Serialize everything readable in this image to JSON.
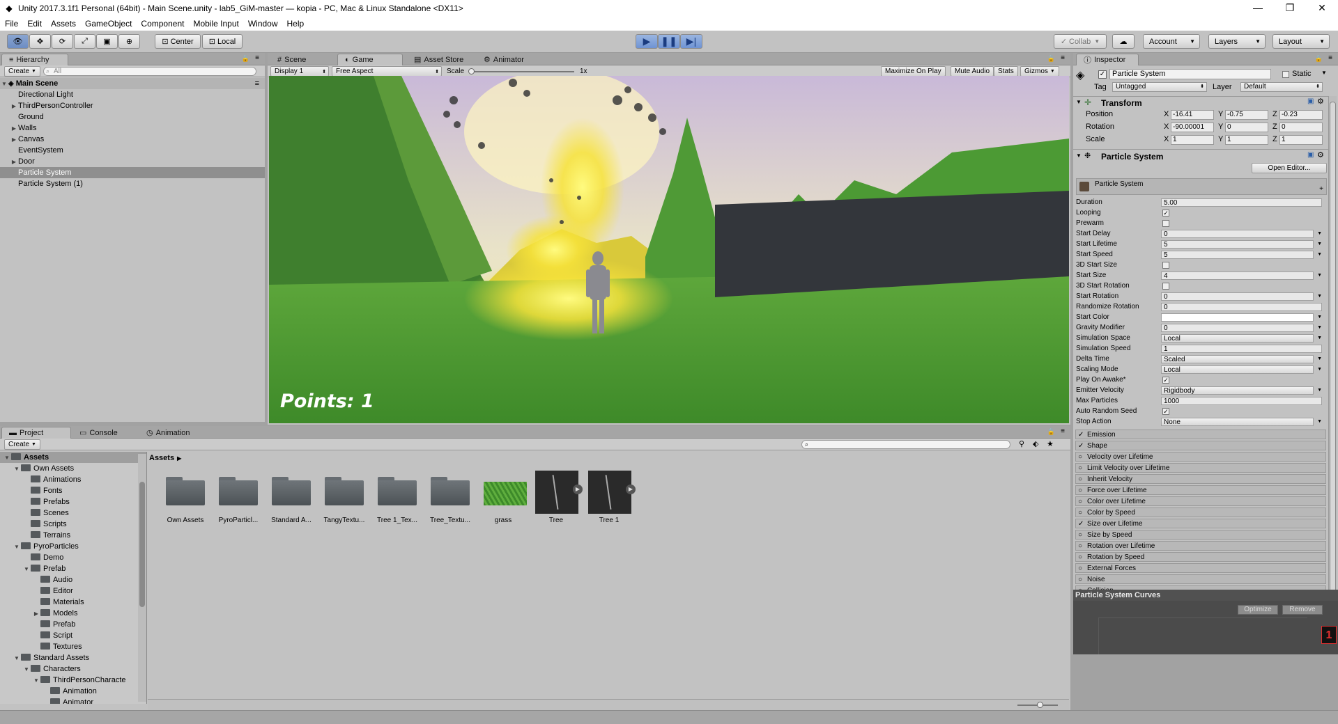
{
  "window": {
    "title": "Unity 2017.3.1f1 Personal (64bit) - Main Scene.unity - lab5_GiM-master — kopia - PC, Mac & Linux Standalone <DX11>",
    "minimize": "—",
    "maximize": "❐",
    "close": "✕"
  },
  "menu": [
    "File",
    "Edit",
    "Assets",
    "GameObject",
    "Component",
    "Mobile Input",
    "Window",
    "Help"
  ],
  "toolbar": {
    "center_label": "Center",
    "local_label": "Local",
    "collab_label": "Collab",
    "account_label": "Account",
    "layers_label": "Layers",
    "layout_label": "Layout"
  },
  "hierarchy": {
    "tab_label": "Hierarchy",
    "create_label": "Create",
    "search_placeholder": "All",
    "scene_name": "Main Scene",
    "items": [
      {
        "label": "Directional Light",
        "expandable": false
      },
      {
        "label": "ThirdPersonController",
        "expandable": true
      },
      {
        "label": "Ground",
        "expandable": false
      },
      {
        "label": "Walls",
        "expandable": true
      },
      {
        "label": "Canvas",
        "expandable": true
      },
      {
        "label": "EventSystem",
        "expandable": false
      },
      {
        "label": "Door",
        "expandable": true
      },
      {
        "label": "Particle System",
        "expandable": false,
        "selected": true
      },
      {
        "label": "Particle System (1)",
        "expandable": false
      }
    ]
  },
  "center_tabs": {
    "scene": "Scene",
    "game": "Game",
    "asset_store": "Asset Store",
    "animator": "Animator"
  },
  "game_bar": {
    "display": "Display 1",
    "aspect": "Free Aspect",
    "scale_label": "Scale",
    "scale_value": "1x",
    "maximize": "Maximize On Play",
    "mute": "Mute Audio",
    "stats": "Stats",
    "gizmos": "Gizmos"
  },
  "game_view": {
    "points_text": "Points: 1"
  },
  "inspector": {
    "tab_label": "Inspector",
    "object_name": "Particle System",
    "static_label": "Static",
    "tag_label": "Tag",
    "tag_value": "Untagged",
    "layer_label": "Layer",
    "layer_value": "Default",
    "transform": {
      "title": "Transform",
      "rows": [
        {
          "label": "Position",
          "x": "-16.41",
          "y": "-0.75",
          "z": "-0.23"
        },
        {
          "label": "Rotation",
          "x": "-90.00001",
          "y": "0",
          "z": "0"
        },
        {
          "label": "Scale",
          "x": "1",
          "y": "1",
          "z": "1"
        }
      ]
    },
    "particle": {
      "title": "Particle System",
      "open_editor": "Open Editor...",
      "sub_header": "Particle System",
      "props": [
        {
          "label": "Duration",
          "value": "5.00"
        },
        {
          "label": "Looping",
          "check": true
        },
        {
          "label": "Prewarm",
          "check": false
        },
        {
          "label": "Start Delay",
          "value": "0",
          "dd": true
        },
        {
          "label": "Start Lifetime",
          "value": "5",
          "dd": true
        },
        {
          "label": "Start Speed",
          "value": "5",
          "dd": true
        },
        {
          "label": "3D Start Size",
          "check": false
        },
        {
          "label": "Start Size",
          "value": "4",
          "dd": true
        },
        {
          "label": "3D Start Rotation",
          "check": false
        },
        {
          "label": "Start Rotation",
          "value": "0",
          "dd": true
        },
        {
          "label": "Randomize Rotation",
          "value": "0"
        },
        {
          "label": "Start Color",
          "color": "#ffffff"
        },
        {
          "label": "Gravity Modifier",
          "value": "0",
          "dd": true
        },
        {
          "label": "Simulation Space",
          "value": "Local",
          "dd": true
        },
        {
          "label": "Simulation Speed",
          "value": "1"
        },
        {
          "label": "Delta Time",
          "value": "Scaled",
          "dd": true
        },
        {
          "label": "Scaling Mode",
          "value": "Local",
          "dd": true
        },
        {
          "label": "Play On Awake*",
          "check": true
        },
        {
          "label": "Emitter Velocity",
          "value": "Rigidbody",
          "dd": true
        },
        {
          "label": "Max Particles",
          "value": "1000"
        },
        {
          "label": "Auto Random Seed",
          "check": true
        },
        {
          "label": "Stop Action",
          "value": "None",
          "dd": true
        }
      ],
      "modules": [
        {
          "label": "Emission",
          "on": true
        },
        {
          "label": "Shape",
          "on": true
        },
        {
          "label": "Velocity over Lifetime",
          "on": false
        },
        {
          "label": "Limit Velocity over Lifetime",
          "on": false
        },
        {
          "label": "Inherit Velocity",
          "on": false
        },
        {
          "label": "Force over Lifetime",
          "on": false
        },
        {
          "label": "Color over Lifetime",
          "on": false
        },
        {
          "label": "Color by Speed",
          "on": false
        },
        {
          "label": "Size over Lifetime",
          "on": true
        },
        {
          "label": "Size by Speed",
          "on": false
        },
        {
          "label": "Rotation over Lifetime",
          "on": false
        },
        {
          "label": "Rotation by Speed",
          "on": false
        },
        {
          "label": "External Forces",
          "on": false
        },
        {
          "label": "Noise",
          "on": false
        },
        {
          "label": "Collision",
          "on": false
        }
      ]
    },
    "curves": {
      "title": "Particle System Curves",
      "optimize": "Optimize",
      "remove": "Remove",
      "value_marker": "1"
    }
  },
  "bottom_tabs": {
    "project": "Project",
    "console": "Console",
    "animation": "Animation"
  },
  "project": {
    "create_label": "Create",
    "breadcrumb": "Assets",
    "tree": [
      {
        "label": "Assets",
        "depth": 0,
        "arrow": "▼",
        "bold": true
      },
      {
        "label": "Own Assets",
        "depth": 1,
        "arrow": "▼"
      },
      {
        "label": "Animations",
        "depth": 2,
        "arrow": ""
      },
      {
        "label": "Fonts",
        "depth": 2,
        "arrow": ""
      },
      {
        "label": "Prefabs",
        "depth": 2,
        "arrow": ""
      },
      {
        "label": "Scenes",
        "depth": 2,
        "arrow": ""
      },
      {
        "label": "Scripts",
        "depth": 2,
        "arrow": ""
      },
      {
        "label": "Terrains",
        "depth": 2,
        "arrow": ""
      },
      {
        "label": "PyroParticles",
        "depth": 1,
        "arrow": "▼"
      },
      {
        "label": "Demo",
        "depth": 2,
        "arrow": ""
      },
      {
        "label": "Prefab",
        "depth": 2,
        "arrow": "▼"
      },
      {
        "label": "Audio",
        "depth": 3,
        "arrow": ""
      },
      {
        "label": "Editor",
        "depth": 3,
        "arrow": ""
      },
      {
        "label": "Materials",
        "depth": 3,
        "arrow": ""
      },
      {
        "label": "Models",
        "depth": 3,
        "arrow": "▶"
      },
      {
        "label": "Prefab",
        "depth": 3,
        "arrow": ""
      },
      {
        "label": "Script",
        "depth": 3,
        "arrow": ""
      },
      {
        "label": "Textures",
        "depth": 3,
        "arrow": ""
      },
      {
        "label": "Standard Assets",
        "depth": 1,
        "arrow": "▼"
      },
      {
        "label": "Characters",
        "depth": 2,
        "arrow": "▼"
      },
      {
        "label": "ThirdPersonCharacte",
        "depth": 3,
        "arrow": "▼"
      },
      {
        "label": "Animation",
        "depth": 4,
        "arrow": ""
      },
      {
        "label": "Animator",
        "depth": 4,
        "arrow": ""
      }
    ],
    "assets": [
      {
        "label": "Own Assets",
        "kind": "folder"
      },
      {
        "label": "PyroParticl...",
        "kind": "folder"
      },
      {
        "label": "Standard A...",
        "kind": "folder"
      },
      {
        "label": "TangyTextu...",
        "kind": "folder"
      },
      {
        "label": "Tree 1_Tex...",
        "kind": "folder"
      },
      {
        "label": "Tree_Textu...",
        "kind": "folder"
      },
      {
        "label": "grass",
        "kind": "texture"
      },
      {
        "label": "Tree",
        "kind": "prefab"
      },
      {
        "label": "Tree 1",
        "kind": "prefab"
      }
    ]
  }
}
